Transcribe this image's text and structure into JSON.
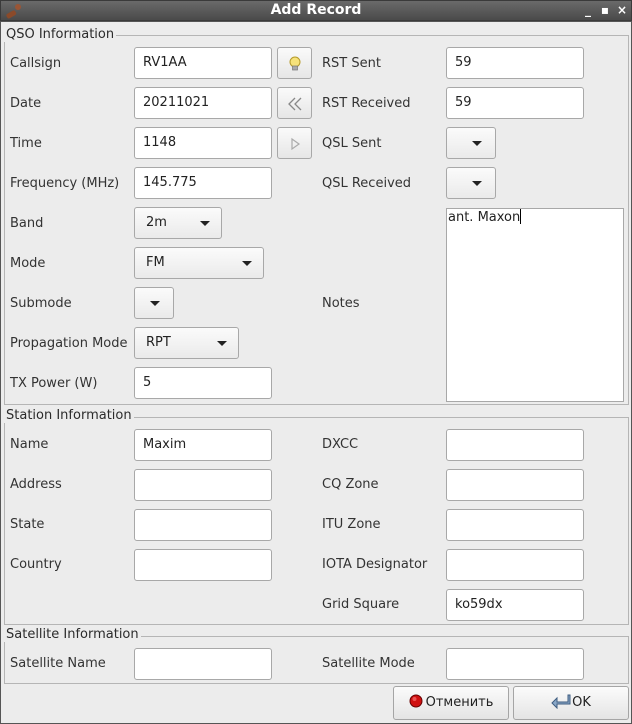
{
  "window": {
    "title": "Add Record",
    "controls": [
      "_",
      "▪",
      "×"
    ]
  },
  "qso": {
    "title": "QSO Information",
    "callsign": {
      "label": "Callsign",
      "value": "RV1AA"
    },
    "date": {
      "label": "Date",
      "value": "20211021"
    },
    "time": {
      "label": "Time",
      "value": "1148"
    },
    "frequency": {
      "label": "Frequency (MHz)",
      "value": "145.775"
    },
    "band": {
      "label": "Band",
      "value": "2m"
    },
    "mode": {
      "label": "Mode",
      "value": "FM"
    },
    "submode": {
      "label": "Submode",
      "value": ""
    },
    "propagation": {
      "label": "Propagation Mode",
      "value": "RPT"
    },
    "tx_power": {
      "label": "TX Power (W)",
      "value": "5"
    },
    "rst_sent": {
      "label": "RST Sent",
      "value": "59"
    },
    "rst_received": {
      "label": "RST Received",
      "value": "59"
    },
    "qsl_sent": {
      "label": "QSL Sent",
      "value": ""
    },
    "qsl_received": {
      "label": "QSL Received",
      "value": ""
    },
    "notes": {
      "label": "Notes",
      "value": "ant. Maxon"
    }
  },
  "station": {
    "title": "Station Information",
    "name": {
      "label": "Name",
      "value": "Maxim"
    },
    "address": {
      "label": "Address",
      "value": ""
    },
    "state": {
      "label": "State",
      "value": ""
    },
    "country": {
      "label": "Country",
      "value": ""
    },
    "dxcc": {
      "label": "DXCC",
      "value": ""
    },
    "cq_zone": {
      "label": "CQ Zone",
      "value": ""
    },
    "itu_zone": {
      "label": "ITU Zone",
      "value": ""
    },
    "iota": {
      "label": "IOTA Designator",
      "value": ""
    },
    "grid": {
      "label": "Grid Square",
      "value": "ko59dx"
    }
  },
  "satellite": {
    "title": "Satellite Information",
    "name": {
      "label": "Satellite Name",
      "value": ""
    },
    "mode": {
      "label": "Satellite Mode",
      "value": ""
    }
  },
  "buttons": {
    "cancel": "Отменить",
    "ok": "OK"
  },
  "colors": {
    "titlebar": "#4a4a4a",
    "cancel_icon": "#d01010"
  }
}
